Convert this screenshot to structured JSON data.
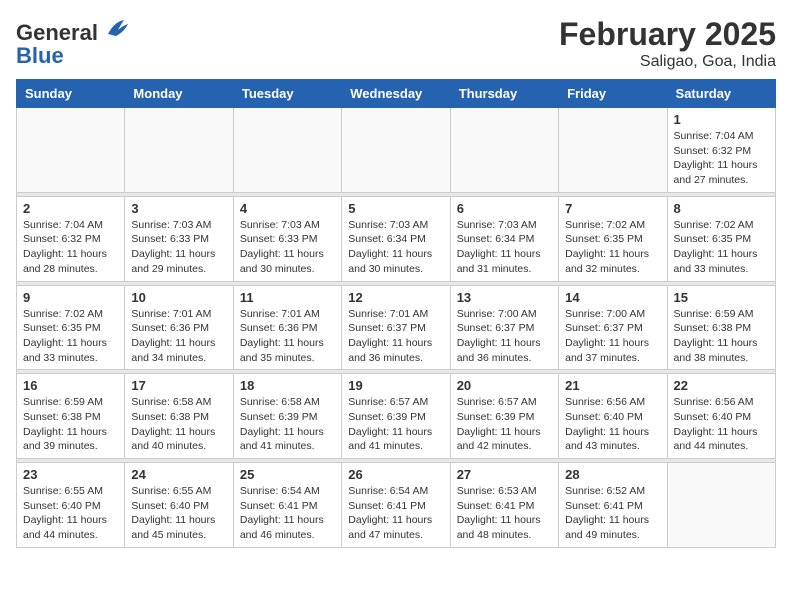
{
  "logo": {
    "general": "General",
    "blue": "Blue"
  },
  "title": "February 2025",
  "subtitle": "Saligao, Goa, India",
  "days_of_week": [
    "Sunday",
    "Monday",
    "Tuesday",
    "Wednesday",
    "Thursday",
    "Friday",
    "Saturday"
  ],
  "weeks": [
    [
      {
        "day": "",
        "info": ""
      },
      {
        "day": "",
        "info": ""
      },
      {
        "day": "",
        "info": ""
      },
      {
        "day": "",
        "info": ""
      },
      {
        "day": "",
        "info": ""
      },
      {
        "day": "",
        "info": ""
      },
      {
        "day": "1",
        "info": "Sunrise: 7:04 AM\nSunset: 6:32 PM\nDaylight: 11 hours and 27 minutes."
      }
    ],
    [
      {
        "day": "2",
        "info": "Sunrise: 7:04 AM\nSunset: 6:32 PM\nDaylight: 11 hours and 28 minutes."
      },
      {
        "day": "3",
        "info": "Sunrise: 7:03 AM\nSunset: 6:33 PM\nDaylight: 11 hours and 29 minutes."
      },
      {
        "day": "4",
        "info": "Sunrise: 7:03 AM\nSunset: 6:33 PM\nDaylight: 11 hours and 30 minutes."
      },
      {
        "day": "5",
        "info": "Sunrise: 7:03 AM\nSunset: 6:34 PM\nDaylight: 11 hours and 30 minutes."
      },
      {
        "day": "6",
        "info": "Sunrise: 7:03 AM\nSunset: 6:34 PM\nDaylight: 11 hours and 31 minutes."
      },
      {
        "day": "7",
        "info": "Sunrise: 7:02 AM\nSunset: 6:35 PM\nDaylight: 11 hours and 32 minutes."
      },
      {
        "day": "8",
        "info": "Sunrise: 7:02 AM\nSunset: 6:35 PM\nDaylight: 11 hours and 33 minutes."
      }
    ],
    [
      {
        "day": "9",
        "info": "Sunrise: 7:02 AM\nSunset: 6:35 PM\nDaylight: 11 hours and 33 minutes."
      },
      {
        "day": "10",
        "info": "Sunrise: 7:01 AM\nSunset: 6:36 PM\nDaylight: 11 hours and 34 minutes."
      },
      {
        "day": "11",
        "info": "Sunrise: 7:01 AM\nSunset: 6:36 PM\nDaylight: 11 hours and 35 minutes."
      },
      {
        "day": "12",
        "info": "Sunrise: 7:01 AM\nSunset: 6:37 PM\nDaylight: 11 hours and 36 minutes."
      },
      {
        "day": "13",
        "info": "Sunrise: 7:00 AM\nSunset: 6:37 PM\nDaylight: 11 hours and 36 minutes."
      },
      {
        "day": "14",
        "info": "Sunrise: 7:00 AM\nSunset: 6:37 PM\nDaylight: 11 hours and 37 minutes."
      },
      {
        "day": "15",
        "info": "Sunrise: 6:59 AM\nSunset: 6:38 PM\nDaylight: 11 hours and 38 minutes."
      }
    ],
    [
      {
        "day": "16",
        "info": "Sunrise: 6:59 AM\nSunset: 6:38 PM\nDaylight: 11 hours and 39 minutes."
      },
      {
        "day": "17",
        "info": "Sunrise: 6:58 AM\nSunset: 6:38 PM\nDaylight: 11 hours and 40 minutes."
      },
      {
        "day": "18",
        "info": "Sunrise: 6:58 AM\nSunset: 6:39 PM\nDaylight: 11 hours and 41 minutes."
      },
      {
        "day": "19",
        "info": "Sunrise: 6:57 AM\nSunset: 6:39 PM\nDaylight: 11 hours and 41 minutes."
      },
      {
        "day": "20",
        "info": "Sunrise: 6:57 AM\nSunset: 6:39 PM\nDaylight: 11 hours and 42 minutes."
      },
      {
        "day": "21",
        "info": "Sunrise: 6:56 AM\nSunset: 6:40 PM\nDaylight: 11 hours and 43 minutes."
      },
      {
        "day": "22",
        "info": "Sunrise: 6:56 AM\nSunset: 6:40 PM\nDaylight: 11 hours and 44 minutes."
      }
    ],
    [
      {
        "day": "23",
        "info": "Sunrise: 6:55 AM\nSunset: 6:40 PM\nDaylight: 11 hours and 44 minutes."
      },
      {
        "day": "24",
        "info": "Sunrise: 6:55 AM\nSunset: 6:40 PM\nDaylight: 11 hours and 45 minutes."
      },
      {
        "day": "25",
        "info": "Sunrise: 6:54 AM\nSunset: 6:41 PM\nDaylight: 11 hours and 46 minutes."
      },
      {
        "day": "26",
        "info": "Sunrise: 6:54 AM\nSunset: 6:41 PM\nDaylight: 11 hours and 47 minutes."
      },
      {
        "day": "27",
        "info": "Sunrise: 6:53 AM\nSunset: 6:41 PM\nDaylight: 11 hours and 48 minutes."
      },
      {
        "day": "28",
        "info": "Sunrise: 6:52 AM\nSunset: 6:41 PM\nDaylight: 11 hours and 49 minutes."
      },
      {
        "day": "",
        "info": ""
      }
    ]
  ]
}
